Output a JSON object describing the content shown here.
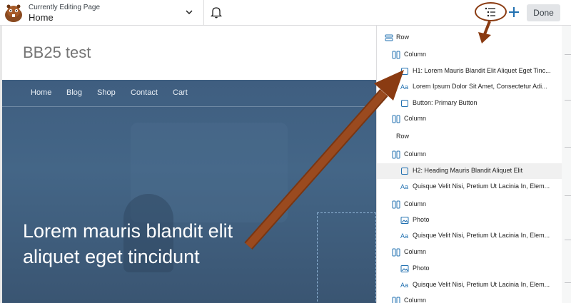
{
  "header": {
    "editing_label": "Currently Editing Page",
    "page_name": "Home",
    "done_label": "Done"
  },
  "canvas": {
    "site_title": "BB25 test",
    "nav": [
      "Home",
      "Blog",
      "Shop",
      "Contact",
      "Cart"
    ],
    "hero_line1": "Lorem mauris blandit elit",
    "hero_line2": "aliquet eget tincidunt"
  },
  "outline": {
    "items": [
      {
        "icon": "row-icon",
        "label": "Row"
      },
      {
        "icon": "column-icon",
        "label": "Column"
      },
      {
        "icon": "heading-icon",
        "label": "H1: Lorem Mauris Blandit Elit Aliquet Eget Tinc..."
      },
      {
        "icon": "text-icon",
        "label": "Lorem Ipsum Dolor Sit Amet, Consectetur Adi..."
      },
      {
        "icon": "button-icon",
        "label": "Button: Primary Button"
      },
      {
        "icon": "column-icon",
        "label": "Column"
      },
      {
        "icon": "none",
        "label": "Row"
      },
      {
        "icon": "column-icon",
        "label": "Column"
      },
      {
        "icon": "heading-icon",
        "label": "H2: Heading Mauris Blandit Aliquet Elit"
      },
      {
        "icon": "text-icon",
        "label": "Quisque Velit Nisi, Pretium Ut Lacinia In, Elem..."
      },
      {
        "icon": "column-icon",
        "label": "Column"
      },
      {
        "icon": "photo-icon",
        "label": "Photo"
      },
      {
        "icon": "text-icon",
        "label": "Quisque Velit Nisi, Pretium Ut Lacinia In, Elem..."
      },
      {
        "icon": "column-icon",
        "label": "Column"
      },
      {
        "icon": "photo-icon",
        "label": "Photo"
      },
      {
        "icon": "text-icon",
        "label": "Quisque Velit Nisi, Pretium Ut Lacinia In, Elem..."
      },
      {
        "icon": "column-icon",
        "label": "Column"
      }
    ]
  },
  "colors": {
    "accent": "#2271b1",
    "annotation": "#8a3b12",
    "hero": "#446687"
  }
}
